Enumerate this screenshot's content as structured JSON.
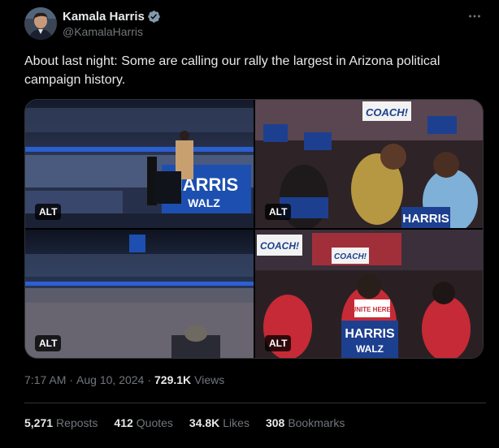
{
  "author": {
    "display_name": "Kamala Harris",
    "handle": "@KamalaHarris"
  },
  "tweet": {
    "text": "About last night: Some are calling our rally the largest in Arizona political campaign history.",
    "time": "7:17 AM",
    "date": "Aug 10, 2024",
    "views_count": "729.1K",
    "views_label": "Views",
    "separator": "·"
  },
  "media": {
    "alt_badges": [
      "ALT",
      "ALT",
      "ALT",
      "ALT"
    ],
    "signs": {
      "harris": "HARRIS",
      "walz": "WALZ",
      "coach": "COACH!",
      "unite_here": "UNITE HERE!"
    }
  },
  "stats": {
    "reposts_count": "5,271",
    "reposts_label": "Reposts",
    "quotes_count": "412",
    "quotes_label": "Quotes",
    "likes_count": "34.8K",
    "likes_label": "Likes",
    "bookmarks_count": "308",
    "bookmarks_label": "Bookmarks"
  },
  "colors": {
    "background": "#000000",
    "text_primary": "#e7e9ea",
    "text_secondary": "#71767b",
    "verified": "#829aab",
    "border": "#2f3336",
    "sign_blue": "#1d3f8f"
  },
  "icons": [
    "verified-badge-icon",
    "more-options-icon"
  ]
}
